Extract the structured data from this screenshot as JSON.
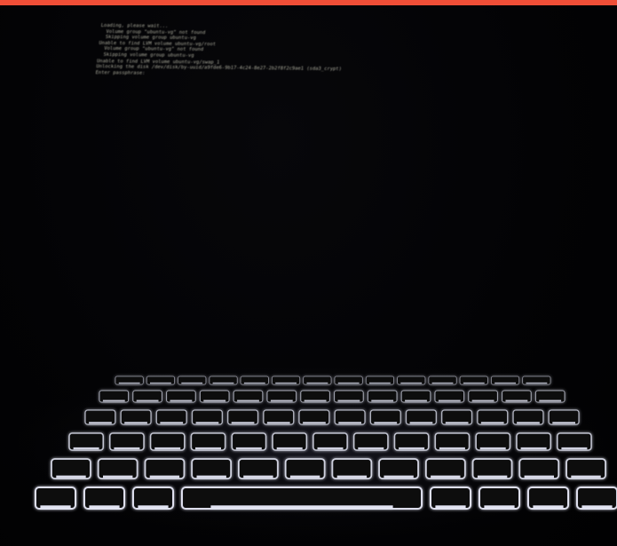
{
  "colors": {
    "top_strip": "#f04e37",
    "screen_bg": "#030305",
    "console_text": "#dcdcc8",
    "key_glow": "#eef0ff",
    "keyboard_deck": "#0b0b10"
  },
  "console": {
    "lines": [
      "Loading, please wait...",
      "  Volume group \"ubuntu-vg\" not found",
      "  Skipping volume group ubuntu-vg",
      "Unable to find LVM volume ubuntu-vg/root",
      "  Volume group \"ubuntu-vg\" not found",
      "  Skipping volume group ubuntu-vg",
      "Unable to find LVM volume ubuntu-vg/swap_1",
      "Unlocking the disk /dev/disk/by-uuid/a9fde6-9b17-4c24-8e27-2b2f8f2c9ae1 (sda3_crypt)",
      "Enter passphrase:"
    ]
  },
  "keyboard": {
    "icon": "backlit-laptop-keyboard",
    "row_key_counts": [
      14,
      14,
      14,
      13,
      12,
      8
    ]
  }
}
